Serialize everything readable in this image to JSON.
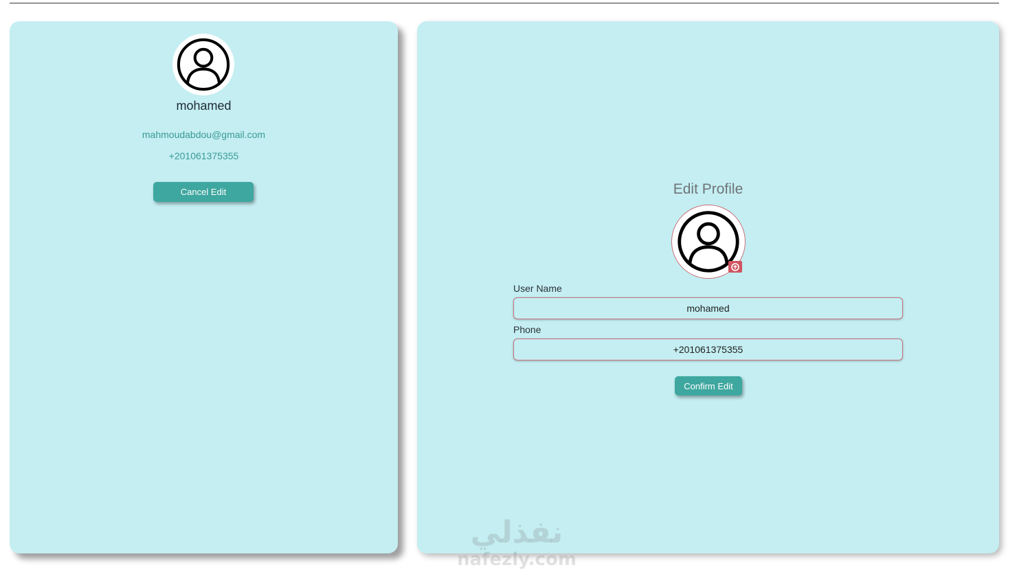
{
  "profile": {
    "name": "mohamed",
    "email": "mahmoudabdou@gmail.com",
    "phone": "+201061375355",
    "cancel_label": "Cancel Edit"
  },
  "edit_form": {
    "title": "Edit Profile",
    "username_label": "User Name",
    "username_value": "mohamed",
    "phone_label": "Phone",
    "phone_value": "+201061375355",
    "confirm_label": "Confirm Edit"
  },
  "icons": {
    "avatar": "user-circle-icon",
    "upload": "camera-upload-icon"
  },
  "watermark": {
    "arabic": "نفذلي",
    "latin": "nafezly.com"
  },
  "colors": {
    "card_background": "#c4eef2",
    "accent_button": "#3ea79f",
    "text_link": "#3a9a94",
    "input_border": "#c9707a",
    "upload_badge": "#cf5560"
  }
}
